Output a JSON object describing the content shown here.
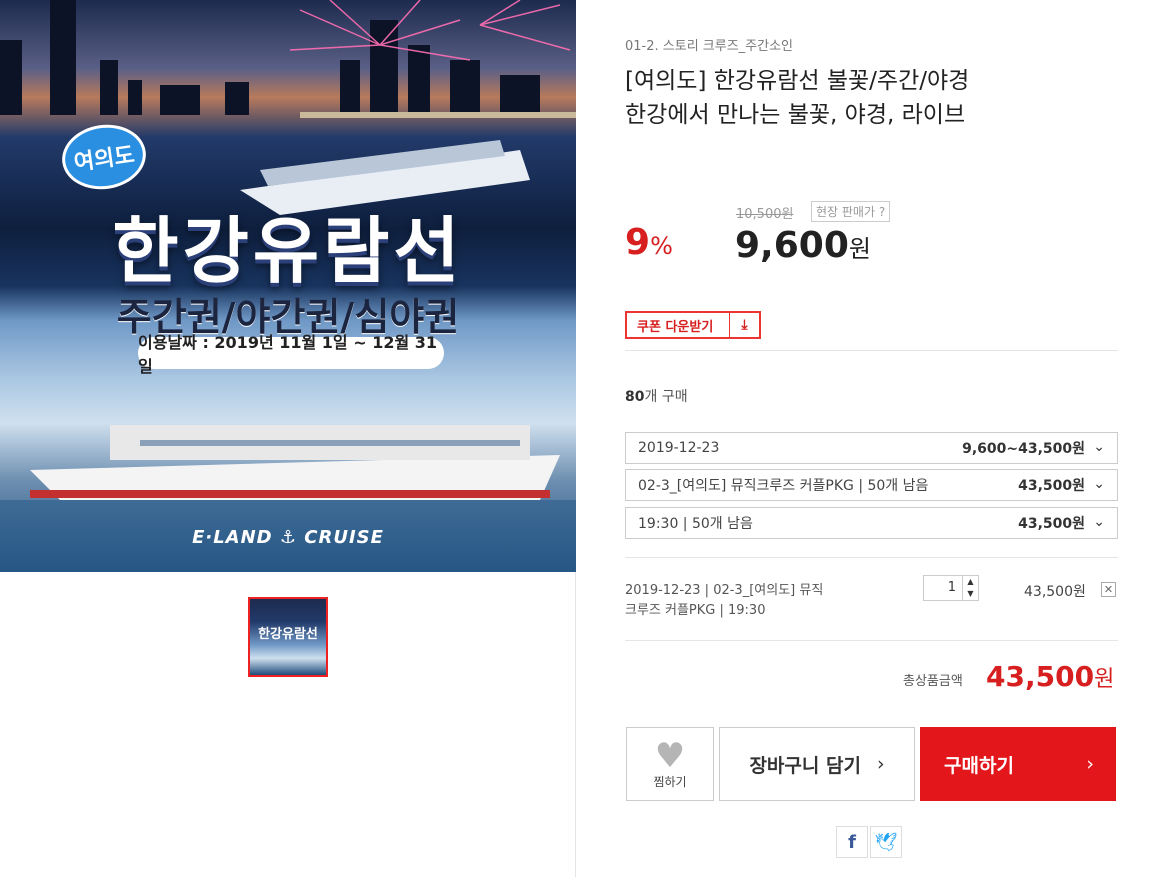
{
  "hero": {
    "badge": "여의도",
    "title": "한강유람선",
    "subtitle": "주간권/야간권/심야권",
    "date": "이용날짜 : 2019년 11월 1일 ~ 12월 31일",
    "brand": "E·LAND ⚓ CRUISE",
    "thumb_text": "한강유람선"
  },
  "product": {
    "category": "01-2. 스토리 크루즈_주간소인",
    "title_line1": "[여의도] 한강유람선 불꽃/주간/야경",
    "title_line2": "한강에서 만나는 불꽃, 야경, 라이브",
    "discount": "9",
    "discount_unit": "%",
    "original_price": "10,500원",
    "original_tag": "현장 판매가 ?",
    "price": "9,600",
    "price_unit": "원"
  },
  "coupon": {
    "label": "쿠폰 다운받기",
    "icon": "download-icon"
  },
  "purchase": {
    "count": "80",
    "label": "개 구매"
  },
  "selects": [
    {
      "label": "2019-12-23",
      "value": "9,600~43,500원"
    },
    {
      "label": "02-3_[여의도] 뮤직크루즈 커플PKG | 50개 남음",
      "value": "43,500원"
    },
    {
      "label": "19:30 | 50개 남음",
      "value": "43,500원"
    }
  ],
  "selected_option": {
    "line1": "2019-12-23 | 02-3_[여의도] 뮤직",
    "line2": "크루즈 커플PKG | 19:30",
    "qty": "1",
    "price": "43,500원",
    "remove": "✕"
  },
  "total": {
    "label": "총상품금액",
    "amount": "43,500",
    "unit": "원"
  },
  "actions": {
    "wish": "찜하기",
    "cart": "장바구니 담기",
    "buy": "구매하기",
    "arrow": "›"
  },
  "share": {
    "facebook": "f",
    "twitter": "🐦"
  },
  "colors": {
    "accent": "#e2161b",
    "discount": "#d71f1f"
  }
}
